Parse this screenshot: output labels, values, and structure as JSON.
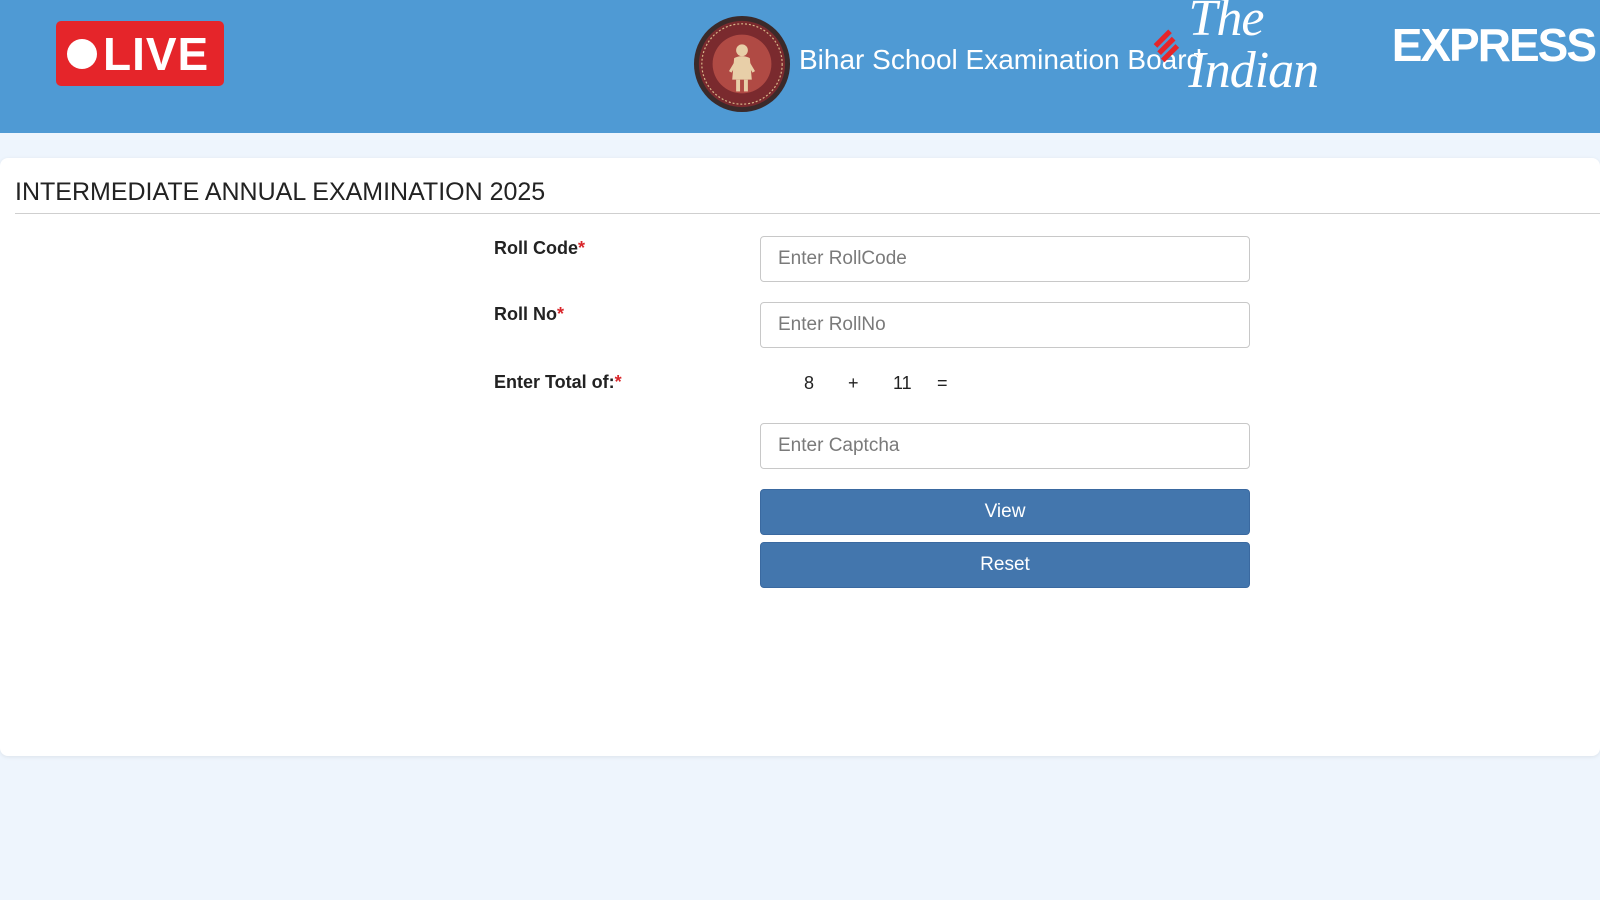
{
  "header": {
    "live_label": "LIVE",
    "board_title": "Bihar School Examination Board",
    "brand_the_indian": "The Indian",
    "brand_express": "EXPRESS",
    "background_color": "#4f9ad4",
    "live_color": "#e5252a"
  },
  "form": {
    "title": "INTERMEDIATE ANNUAL EXAMINATION 2025",
    "roll_code": {
      "label": "Roll Code",
      "required_mark": "*",
      "placeholder": "Enter RollCode",
      "value": ""
    },
    "roll_no": {
      "label": "Roll No",
      "required_mark": "*",
      "placeholder": "Enter RollNo",
      "value": ""
    },
    "captcha": {
      "label": "Enter Total of:",
      "required_mark": "*",
      "operand_a": "8",
      "operator": "+",
      "operand_b": "11",
      "equals": "=",
      "placeholder": "Enter Captcha",
      "value": ""
    },
    "view_button": "View",
    "reset_button": "Reset",
    "button_color": "#4376ad"
  }
}
